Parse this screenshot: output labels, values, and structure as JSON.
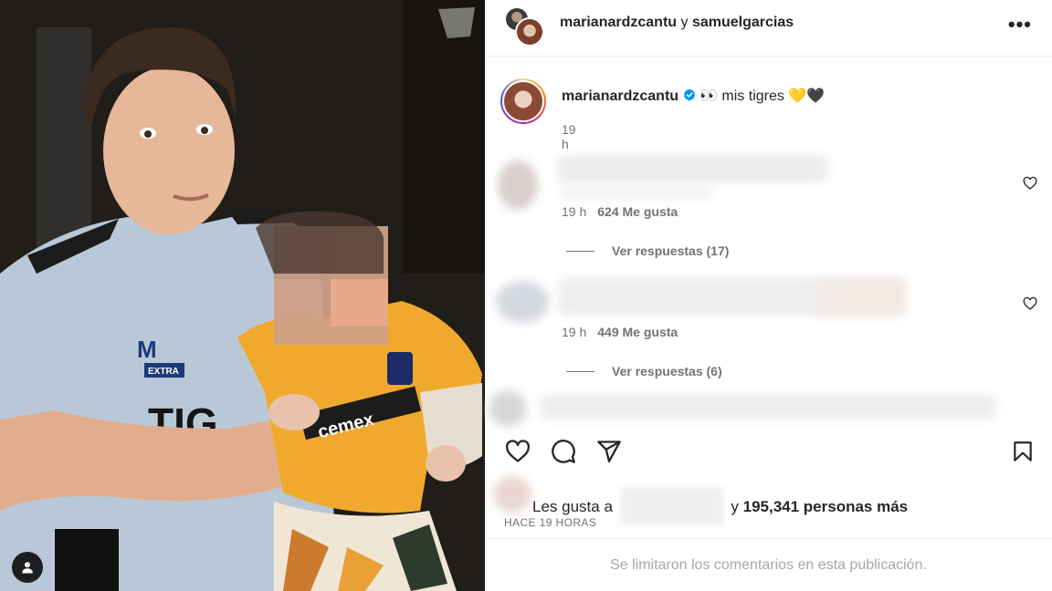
{
  "post": {
    "header": {
      "user1": "marianardzcantu",
      "conjunction": "y",
      "user2": "samuelgarcias",
      "more_icon": "more-options-icon",
      "more_glyph": "•••"
    },
    "caption": {
      "username": "marianardzcantu",
      "verified": true,
      "text": "👀 mis tigres 💛🖤",
      "time": "19 h"
    },
    "comments": [
      {
        "time": "19 h",
        "likes": "624 Me gusta",
        "replies_label": "Ver respuestas (17)"
      },
      {
        "time": "19 h",
        "likes": "449 Me gusta",
        "replies_label": "Ver respuestas (6)"
      }
    ],
    "likes": {
      "prefix": "Les gusta a",
      "joiner": "y",
      "count": "195,341 personas más"
    },
    "age": "HACE 19 HORAS",
    "comments_limited": "Se limitaron los comentarios en esta publicación."
  },
  "colors": {
    "verified": "#0095f6",
    "muted": "#737373",
    "text": "#262626",
    "divider": "#efefef"
  }
}
